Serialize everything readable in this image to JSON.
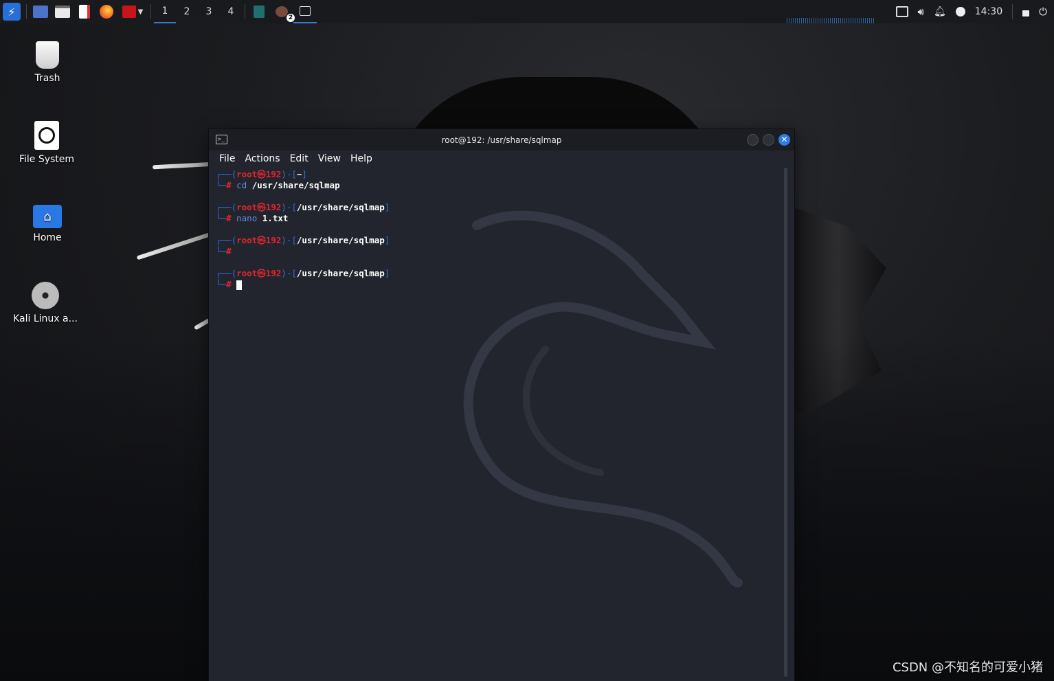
{
  "taskbar": {
    "workspaces": [
      "1",
      "2",
      "3",
      "4"
    ],
    "active_workspace": "1",
    "taskbar_badge": "2",
    "clock": "14:30"
  },
  "desktop": {
    "icons": [
      {
        "label": "Trash"
      },
      {
        "label": "File System"
      },
      {
        "label": "Home"
      },
      {
        "label": "Kali Linux a..."
      }
    ]
  },
  "terminal": {
    "title": "root@192: /usr/share/sqlmap",
    "menu": [
      "File",
      "Actions",
      "Edit",
      "View",
      "Help"
    ],
    "user": "root",
    "host": "192",
    "prompt_hash": "#",
    "blocks": [
      {
        "path": "~",
        "command": "cd",
        "arg": "/usr/share/sqlmap"
      },
      {
        "path": "/usr/share/sqlmap",
        "command": "nano",
        "arg": "1.txt"
      },
      {
        "path": "/usr/share/sqlmap",
        "command": "",
        "arg": ""
      },
      {
        "path": "/usr/share/sqlmap",
        "command": "",
        "arg": ""
      }
    ]
  },
  "watermark": "CSDN @不知名的可爱小猪",
  "colors": {
    "accent": "#2f6ee2",
    "prompt_red": "#e0262b",
    "terminal_bg": "#23252e",
    "panel_bg": "#191a1e"
  }
}
